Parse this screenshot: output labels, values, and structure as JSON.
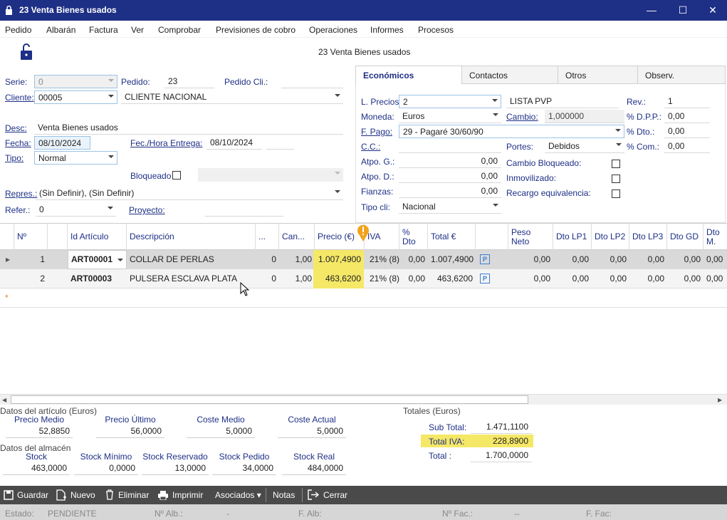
{
  "window": {
    "title": "23 Venta Bienes usados"
  },
  "menu": [
    "Pedido",
    "Albarán",
    "Factura",
    "Ver",
    "Comprobar",
    "Previsiones de cobro",
    "Operaciones",
    "Informes",
    "Procesos"
  ],
  "header": {
    "subtitle": "23 Venta Bienes usados"
  },
  "form": {
    "serie_label": "Serie:",
    "serie_value": "0",
    "pedido_label": "Pedido:",
    "pedido_value": "23",
    "pedido_cli_label": "Pedido Cli.:",
    "pedido_cli_value": "",
    "cliente_label": "Cliente:",
    "cliente_value": "00005",
    "cliente_name": "CLIENTE NACIONAL",
    "desc_label": "Desc:",
    "desc_value": "Venta Bienes usados",
    "fecha_label": "Fecha:",
    "fecha_value": "08/10/2024",
    "fec_entrega_label": "Fec./Hora Entrega:",
    "fec_entrega_value": "08/10/2024",
    "tipo_label": "Tipo:",
    "tipo_value": "Normal",
    "bloqueado_label": "Bloqueado",
    "repres_label": "Repres.:",
    "repres_value": "(Sin Definir), (Sin Definir)",
    "refer_label": "Refer.:",
    "refer_value": "0",
    "proyecto_label": "Proyecto:"
  },
  "tabs": [
    "Económicos",
    "Contactos",
    "Otros",
    "Observ."
  ],
  "economicos": {
    "lprecios_label": "L. Precios",
    "lprecios_value": "2",
    "lprecios_name": "LISTA PVP",
    "rev_label": "Rev.:",
    "rev_value": "1",
    "moneda_label": "Moneda:",
    "moneda_value": "Euros",
    "cambio_label": "Cambio:",
    "cambio_value": "1,000000",
    "dpp_label": "% D.P.P.:",
    "dpp_value": "0,00",
    "fpago_label": "F. Pago:",
    "fpago_value": "29 - Pagaré 30/60/90",
    "dto_label": "% Dto.:",
    "dto_value": "0,00",
    "cc_label": "C.C.:",
    "portes_label": "Portes:",
    "portes_value": "Debidos",
    "com_label": "% Com.:",
    "com_value": "0,00",
    "atpog_label": "Atpo. G.:",
    "atpog_value": "0,00",
    "cambio_bloq_label": "Cambio Bloqueado:",
    "atpod_label": "Atpo. D.:",
    "atpod_value": "0,00",
    "inmov_label": "Inmovilizado:",
    "fianzas_label": "Fianzas:",
    "fianzas_value": "0,00",
    "recargo_label": "Recargo equivalencia:",
    "tipocli_label": "Tipo cli:",
    "tipocli_value": "Nacional"
  },
  "grid": {
    "headers": [
      "Nº",
      "Id Artículo",
      "Descripción",
      "...",
      "Can...",
      "Precio (€)",
      "IVA",
      "% Dto",
      "Total €",
      "",
      "Peso Neto",
      "Dto LP1",
      "Dto LP2",
      "Dto LP3",
      "Dto GD",
      "Dto M."
    ],
    "rows": [
      {
        "n": "1",
        "id": "ART00001",
        "desc": "COLLAR DE PERLAS",
        "dots": "0",
        "cant": "1,00",
        "precio": "1.007,4900",
        "iva": "21% (8)",
        "dto": "0,00",
        "total": "1.007,4900",
        "p": "P",
        "peso": "0,00",
        "lp1": "0,00",
        "lp2": "0,00",
        "lp3": "0,00",
        "gd": "0,00",
        "m": "0,00"
      },
      {
        "n": "2",
        "id": "ART00003",
        "desc": "PULSERA ESCLAVA PLATA",
        "dots": "0",
        "cant": "1,00",
        "precio": "463,6200",
        "iva": "21% (8)",
        "dto": "0,00",
        "total": "463,6200",
        "p": "P",
        "peso": "0,00",
        "lp1": "0,00",
        "lp2": "0,00",
        "lp3": "0,00",
        "gd": "0,00",
        "m": "0,00"
      }
    ]
  },
  "articulo": {
    "title": "Datos del artículo (Euros)",
    "items": [
      {
        "label": "Precio Medio",
        "value": "52,8850"
      },
      {
        "label": "Precio Último",
        "value": "56,0000"
      },
      {
        "label": "Coste Medio",
        "value": "5,0000"
      },
      {
        "label": "Coste Actual",
        "value": "5,0000"
      }
    ]
  },
  "almacen": {
    "title": "Datos del almacén",
    "items": [
      {
        "label": "Stock",
        "value": "463,0000"
      },
      {
        "label": "Stock Mínimo",
        "value": "0,0000"
      },
      {
        "label": "Stock Reservado",
        "value": "13,0000"
      },
      {
        "label": "Stock Pedido",
        "value": "34,0000"
      },
      {
        "label": "Stock Real",
        "value": "484,0000"
      }
    ]
  },
  "totales": {
    "title": "Totales (Euros)",
    "subtotal_label": "Sub Total:",
    "subtotal_value": "1.471,1100",
    "iva_label": "Total IVA:",
    "iva_value": "228,8900",
    "total_label": "Total :",
    "total_value": "1.700,0000"
  },
  "toolbar": {
    "guardar": "Guardar",
    "nuevo": "Nuevo",
    "eliminar": "Eliminar",
    "imprimir": "Imprimir",
    "asociados": "Asociados",
    "notas": "Notas",
    "cerrar": "Cerrar"
  },
  "status": {
    "estado_label": "Estado:",
    "estado_value": "PENDIENTE",
    "alb_label": "Nº Alb.:",
    "alb_value": "-",
    "falb_label": "F. Alb:",
    "fac_label": "Nº Fac.:",
    "fac_value": "--",
    "ffac_label": "F. Fac:"
  },
  "colors": {
    "titlebar": "#1e2f86",
    "highlight": "#f5e867",
    "accent": "#1e2f86"
  }
}
